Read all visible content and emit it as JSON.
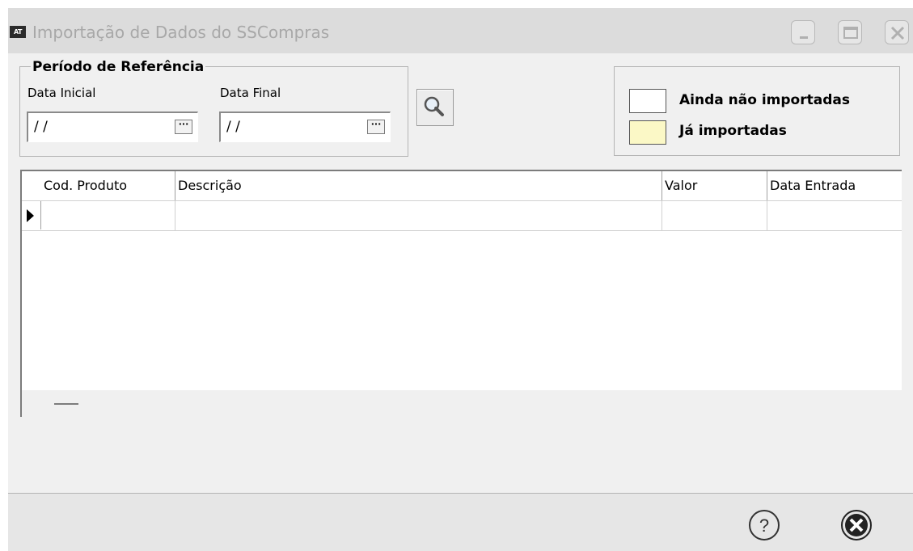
{
  "window": {
    "icon_text": "AT",
    "title": "Importação de Dados do SSCompras",
    "controls": [
      "minimize-icon",
      "maximize-icon",
      "close-icon"
    ]
  },
  "period": {
    "group_title": "Período de Referência",
    "start_label": "Data Inicial",
    "start_value": "/ /",
    "end_label": "Data Final",
    "end_value": "/ /",
    "picker_label": "···",
    "search_icon": "magnifier-icon"
  },
  "legend": {
    "not_imported_label": "Ainda não importadas",
    "not_imported_color": "#ffffff",
    "imported_label": "Já importadas",
    "imported_color": "#fbf8c6"
  },
  "grid": {
    "columns": [
      "Cod. Produto",
      "Descrição",
      "Valor",
      "Data Entrada"
    ],
    "rows": [
      {
        "cod_produto": "",
        "descricao": "",
        "valor": "",
        "data_entrada": ""
      }
    ],
    "current_row_icon": "row-pointer-icon"
  },
  "footer": {
    "help_icon": "help-icon",
    "cancel_icon": "cancel-icon"
  }
}
